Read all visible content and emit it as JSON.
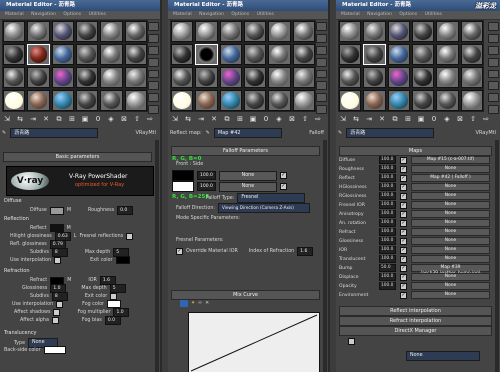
{
  "panels": [
    {
      "title": "Material Editor - 沥青路",
      "menu": [
        "Material",
        "Navigation",
        "Options",
        "Utilities"
      ],
      "mat_name": "沥青路",
      "mat_type": "VRayMtl"
    },
    {
      "title": "Material Editor - 沥青路",
      "menu": [
        "Material",
        "Navigation",
        "Options",
        "Utilities"
      ],
      "mat_name": "Map #42",
      "mat_type": "Falloff",
      "reflect_label": "Reflect map:"
    },
    {
      "title": "Material Editor - 沥青路",
      "menu": [
        "Material",
        "Navigation",
        "Options",
        "Utilities"
      ],
      "mat_name": "沥青路",
      "mat_type": "VRayMtl"
    }
  ],
  "p1": {
    "basic": "Basic parameters",
    "logo_text": "V-Ray PowerShader",
    "logo_sub": "optimized for V-Ray",
    "diffuse_sect": "Diffuse",
    "diffuse": "Diffuse",
    "m": "M",
    "roughness": "Roughness",
    "roughness_v": "0.0",
    "reflection": "Reflection",
    "reflect": "Reflect",
    "hilight": "Hilight glossiness",
    "hilight_v": "0.63",
    "l": "L",
    "fresnel": "Fresnel reflections",
    "refl_gloss": "Refl. glossiness",
    "refl_gloss_v": "0.79",
    "subdivs": "Subdivs",
    "subdivs_v": "8",
    "interp": "Use interpolation",
    "max_depth": "Max depth",
    "max_depth_v": "5",
    "exit_color": "Exit color",
    "refraction": "Refraction",
    "refract": "Refract",
    "ior": "IOR",
    "ior_v": "1.6",
    "glossiness": "Glossiness",
    "glossiness_v": "1.0",
    "max_depth2_v": "5",
    "subdivs2_v": "8",
    "exit_color2": "Exit color",
    "use_interp": "Use interpolation",
    "fog_color": "Fog color",
    "affect_shadows": "Affect shadows",
    "fog_mult": "Fog multiplier",
    "fog_mult_v": "1.0",
    "affect_alpha": "Affect alpha",
    "fog_bias": "Fog bias",
    "fog_bias_v": "0.0",
    "translucency": "Translucency",
    "type": "Type",
    "type_v": "None",
    "back_side": "Back-side color"
  },
  "p2": {
    "falloff_params": "Falloff Parameters",
    "front_side": "Front : Side",
    "row1_v": "100.0",
    "row1_m": "None",
    "row2_v": "100.0",
    "row2_m": "None",
    "falloff_type": "Falloff Type:",
    "falloff_type_v": "Fresnel",
    "falloff_dir": "Falloff Direction:",
    "falloff_dir_v": "Viewing Direction (Camera Z-Axis)",
    "mode_specific": "Mode Specific Parameters:",
    "fresnel_params": "Fresnel Parameters:",
    "override": "Override Material IOR",
    "ior_refr": "Index of Refraction",
    "ior_refr_v": "1.6",
    "mix_curve": "Mix Curve",
    "green1": "R, G, B=0",
    "green2": "R, G, B=255"
  },
  "p3": {
    "maps": "Maps",
    "rows": [
      {
        "l": "Diffuse",
        "v": "100.0",
        "m": "Map #15 (c-a-007.tif)"
      },
      {
        "l": "Roughness",
        "v": "100.0",
        "m": "None"
      },
      {
        "l": "Reflect",
        "v": "100.0",
        "m": "Map #42  ( Falloff )"
      },
      {
        "l": "HGlossiness",
        "v": "100.0",
        "m": "None"
      },
      {
        "l": "RGlossiness",
        "v": "100.0",
        "m": "None"
      },
      {
        "l": "Fresnel IOR",
        "v": "100.0",
        "m": "None"
      },
      {
        "l": "Anisotropy",
        "v": "100.0",
        "m": "None"
      },
      {
        "l": "An. rotation",
        "v": "100.0",
        "m": "None"
      },
      {
        "l": "Refract",
        "v": "100.0",
        "m": "None"
      },
      {
        "l": "Glossiness",
        "v": "100.0",
        "m": "None"
      },
      {
        "l": "IOR",
        "v": "100.0",
        "m": "None"
      },
      {
        "l": "Translucent",
        "v": "100.0",
        "m": "None"
      },
      {
        "l": "Bump",
        "v": "50.0",
        "m": "Map #39 (asch39_leather_bump.jpg)"
      },
      {
        "l": "Displace",
        "v": "100.0",
        "m": "None"
      },
      {
        "l": "Opacity",
        "v": "100.0",
        "m": "None"
      },
      {
        "l": "Environment",
        "v": "",
        "m": "None"
      }
    ],
    "reflect_interp": "Reflect interpolation",
    "refract_interp": "Refract interpolation",
    "directx": "DirectX Manager",
    "none_dd": "None"
  },
  "watermark": "溢彩龙",
  "colors": {
    "title": "#3a5a88",
    "accent_green": "#35e03a",
    "bg": "#444444"
  }
}
